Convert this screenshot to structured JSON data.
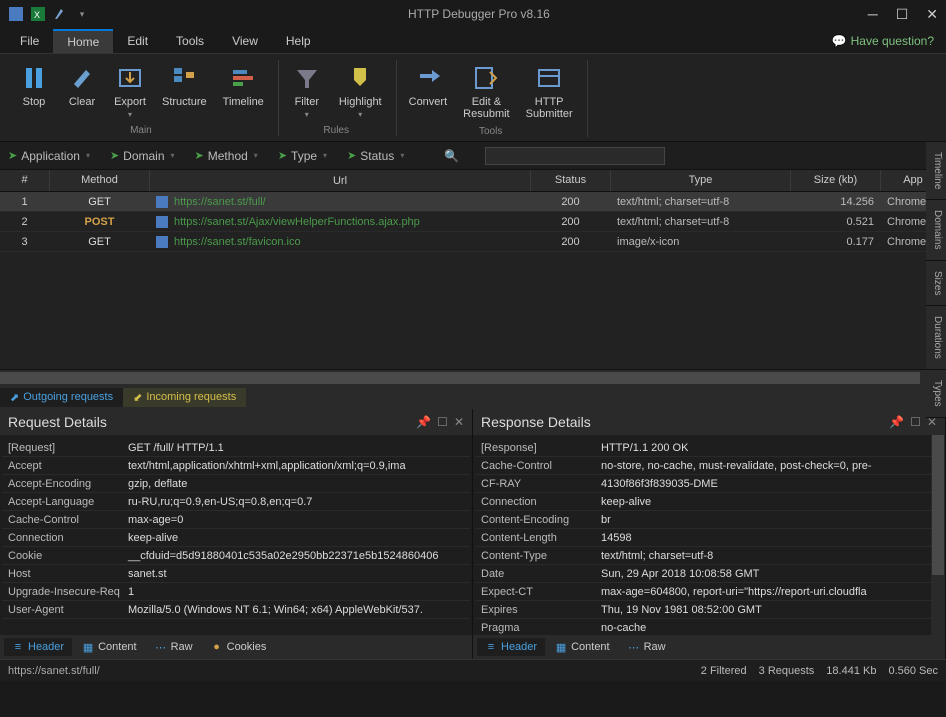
{
  "title": "HTTP Debugger Pro v8.16",
  "menu": {
    "file": "File",
    "home": "Home",
    "edit": "Edit",
    "tools": "Tools",
    "view": "View",
    "help": "Help",
    "question": "Have question?"
  },
  "ribbon": {
    "stop": "Stop",
    "clear": "Clear",
    "export": "Export",
    "structure": "Structure",
    "timeline": "Timeline",
    "filter": "Filter",
    "highlight": "Highlight",
    "convert": "Convert",
    "edit_resubmit": "Edit &\nResubmit",
    "http_submitter": "HTTP\nSubmitter",
    "main_group": "Main",
    "rules_group": "Rules",
    "tools_group": "Tools"
  },
  "filters": {
    "application": "Application",
    "domain": "Domain",
    "method": "Method",
    "type": "Type",
    "status": "Status"
  },
  "grid": {
    "headers": {
      "num": "#",
      "method": "Method",
      "url": "Url",
      "status": "Status",
      "type": "Type",
      "size": "Size (kb)",
      "app": "App"
    },
    "rows": [
      {
        "num": "1",
        "method": "GET",
        "mclass": "m-get",
        "url": "https://sanet.st/full/",
        "status": "200",
        "type": "text/html; charset=utf-8",
        "size": "14.256",
        "app": "Chrome.e"
      },
      {
        "num": "2",
        "method": "POST",
        "mclass": "m-post",
        "url": "https://sanet.st/Ajax/viewHelperFunctions.ajax.php",
        "status": "200",
        "type": "text/html; charset=utf-8",
        "size": "0.521",
        "app": "Chrome.e"
      },
      {
        "num": "3",
        "method": "GET",
        "mclass": "m-get",
        "url": "https://sanet.st/favicon.ico",
        "status": "200",
        "type": "image/x-icon",
        "size": "0.177",
        "app": "Chrome.e"
      }
    ]
  },
  "reqtabs": {
    "outgoing": "Outgoing requests",
    "incoming": "Incoming requests"
  },
  "request_panel": {
    "title": "Request Details",
    "rows": [
      {
        "k": "[Request]",
        "v": "GET /full/ HTTP/1.1"
      },
      {
        "k": "Accept",
        "v": "text/html,application/xhtml+xml,application/xml;q=0.9,ima"
      },
      {
        "k": "Accept-Encoding",
        "v": "gzip, deflate"
      },
      {
        "k": "Accept-Language",
        "v": "ru-RU,ru;q=0.9,en-US;q=0.8,en;q=0.7"
      },
      {
        "k": "Cache-Control",
        "v": "max-age=0"
      },
      {
        "k": "Connection",
        "v": "keep-alive"
      },
      {
        "k": "Cookie",
        "v": "__cfduid=d5d91880401c535a02e2950bb22371e5b1524860406"
      },
      {
        "k": "Host",
        "v": "sanet.st"
      },
      {
        "k": "Upgrade-Insecure-Req",
        "v": "1"
      },
      {
        "k": "User-Agent",
        "v": "Mozilla/5.0 (Windows NT 6.1; Win64; x64) AppleWebKit/537."
      }
    ],
    "tabs": {
      "header": "Header",
      "content": "Content",
      "raw": "Raw",
      "cookies": "Cookies"
    }
  },
  "response_panel": {
    "title": "Response Details",
    "rows": [
      {
        "k": "[Response]",
        "v": "HTTP/1.1 200 OK"
      },
      {
        "k": "Cache-Control",
        "v": "no-store, no-cache, must-revalidate, post-check=0, pre-"
      },
      {
        "k": "CF-RAY",
        "v": "4130f86f3f839035-DME"
      },
      {
        "k": "Connection",
        "v": "keep-alive"
      },
      {
        "k": "Content-Encoding",
        "v": "br"
      },
      {
        "k": "Content-Length",
        "v": "14598"
      },
      {
        "k": "Content-Type",
        "v": "text/html; charset=utf-8"
      },
      {
        "k": "Date",
        "v": "Sun, 29 Apr 2018 10:08:58 GMT"
      },
      {
        "k": "Expect-CT",
        "v": "max-age=604800, report-uri=\"https://report-uri.cloudfla"
      },
      {
        "k": "Expires",
        "v": "Thu, 19 Nov 1981 08:52:00 GMT"
      },
      {
        "k": "Pragma",
        "v": "no-cache"
      }
    ],
    "tabs": {
      "header": "Header",
      "content": "Content",
      "raw": "Raw"
    }
  },
  "statusbar": {
    "left": "https://sanet.st/full/",
    "filtered": "2 Filtered",
    "requests": "3 Requests",
    "kb": "18.441 Kb",
    "sec": "0.560 Sec"
  },
  "side_tabs": [
    "Timeline",
    "Domains",
    "Sizes",
    "Durations",
    "Types"
  ]
}
